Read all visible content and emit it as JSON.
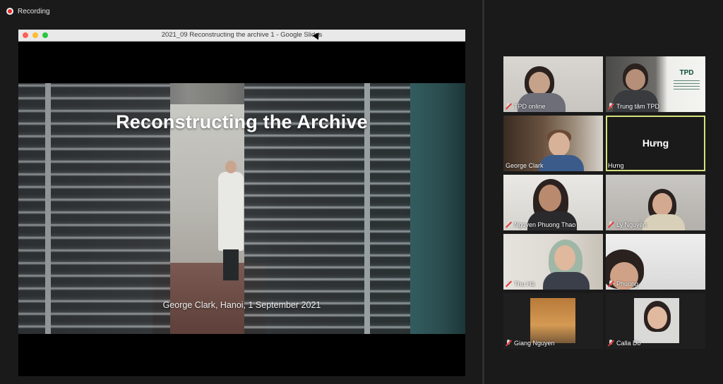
{
  "recording": {
    "label": "Recording"
  },
  "window": {
    "title": "2021_09 Reconstructing the archive 1 - Google Slides"
  },
  "slide": {
    "title": "Reconstructing the Archive",
    "caption": "George Clark, Hanoi, 1 September 2021"
  },
  "participants": [
    {
      "name": "TPD online",
      "muted": true
    },
    {
      "name": "Trung tâm TPD",
      "muted": true
    },
    {
      "name": "George Clark",
      "muted": false
    },
    {
      "name": "Hưng",
      "muted": false,
      "active": true,
      "display": "Hưng"
    },
    {
      "name": "Nguyen Phuong Thao",
      "muted": true
    },
    {
      "name": "Ly Nguyễn",
      "muted": true
    },
    {
      "name": "Thu Hà",
      "muted": true
    },
    {
      "name": "Phuong",
      "muted": true
    },
    {
      "name": "Giang Nguyen",
      "muted": true
    },
    {
      "name": "Calla Do",
      "muted": true
    }
  ],
  "logo": {
    "text": "TPD"
  },
  "colors": {
    "active_outline": "#d6e27a",
    "muted_red": "#e23b3b",
    "background": "#1a1a1a"
  }
}
